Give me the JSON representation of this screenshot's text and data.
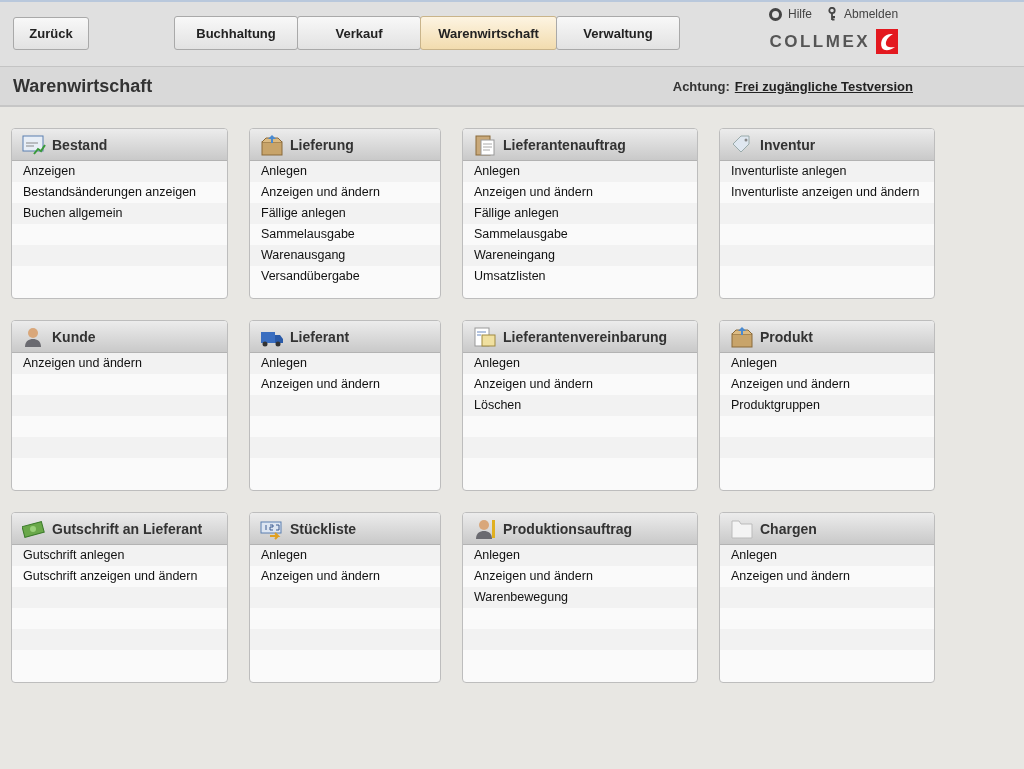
{
  "back_button": "Zurück",
  "tabs": [
    {
      "label": "Buchhaltung",
      "selected": false
    },
    {
      "label": "Verkauf",
      "selected": false
    },
    {
      "label": "Warenwirtschaft",
      "selected": true
    },
    {
      "label": "Verwaltung",
      "selected": false
    }
  ],
  "top_links": {
    "help": "Hilfe",
    "logout": "Abmelden"
  },
  "logo": "COLLMEX",
  "page_title": "Warenwirtschaft",
  "notice": {
    "label": "Achtung:",
    "link": "Frei zugängliche Testversion"
  },
  "cards": [
    {
      "title": "Bestand",
      "items": [
        "Anzeigen",
        "Bestandsänderungen anzeigen",
        "Buchen allgemein"
      ]
    },
    {
      "title": "Lieferung",
      "items": [
        "Anlegen",
        "Anzeigen und ändern",
        "Fällige anlegen",
        "Sammelausgabe",
        "Warenausgang",
        "Versandübergabe"
      ]
    },
    {
      "title": "Lieferantenauftrag",
      "items": [
        "Anlegen",
        "Anzeigen und ändern",
        "Fällige anlegen",
        "Sammelausgabe",
        "Wareneingang",
        "Umsatzlisten"
      ]
    },
    {
      "title": "Inventur",
      "items": [
        "Inventurliste anlegen",
        "Inventurliste anzeigen und ändern"
      ]
    },
    {
      "title": "Kunde",
      "items": [
        "Anzeigen und ändern"
      ]
    },
    {
      "title": "Lieferant",
      "items": [
        "Anlegen",
        "Anzeigen und ändern"
      ]
    },
    {
      "title": "Lieferantenvereinbarung",
      "items": [
        "Anlegen",
        "Anzeigen und ändern",
        "Löschen"
      ]
    },
    {
      "title": "Produkt",
      "items": [
        "Anlegen",
        "Anzeigen und ändern",
        "Produktgruppen"
      ]
    },
    {
      "title": "Gutschrift an Lieferant",
      "items": [
        "Gutschrift anlegen",
        "Gutschrift anzeigen und ändern"
      ]
    },
    {
      "title": "Stückliste",
      "items": [
        "Anlegen",
        "Anzeigen und ändern"
      ]
    },
    {
      "title": "Produktionsauftrag",
      "items": [
        "Anlegen",
        "Anzeigen und ändern",
        "Warenbewegung"
      ]
    },
    {
      "title": "Chargen",
      "items": [
        "Anlegen",
        "Anzeigen und ändern"
      ]
    }
  ]
}
